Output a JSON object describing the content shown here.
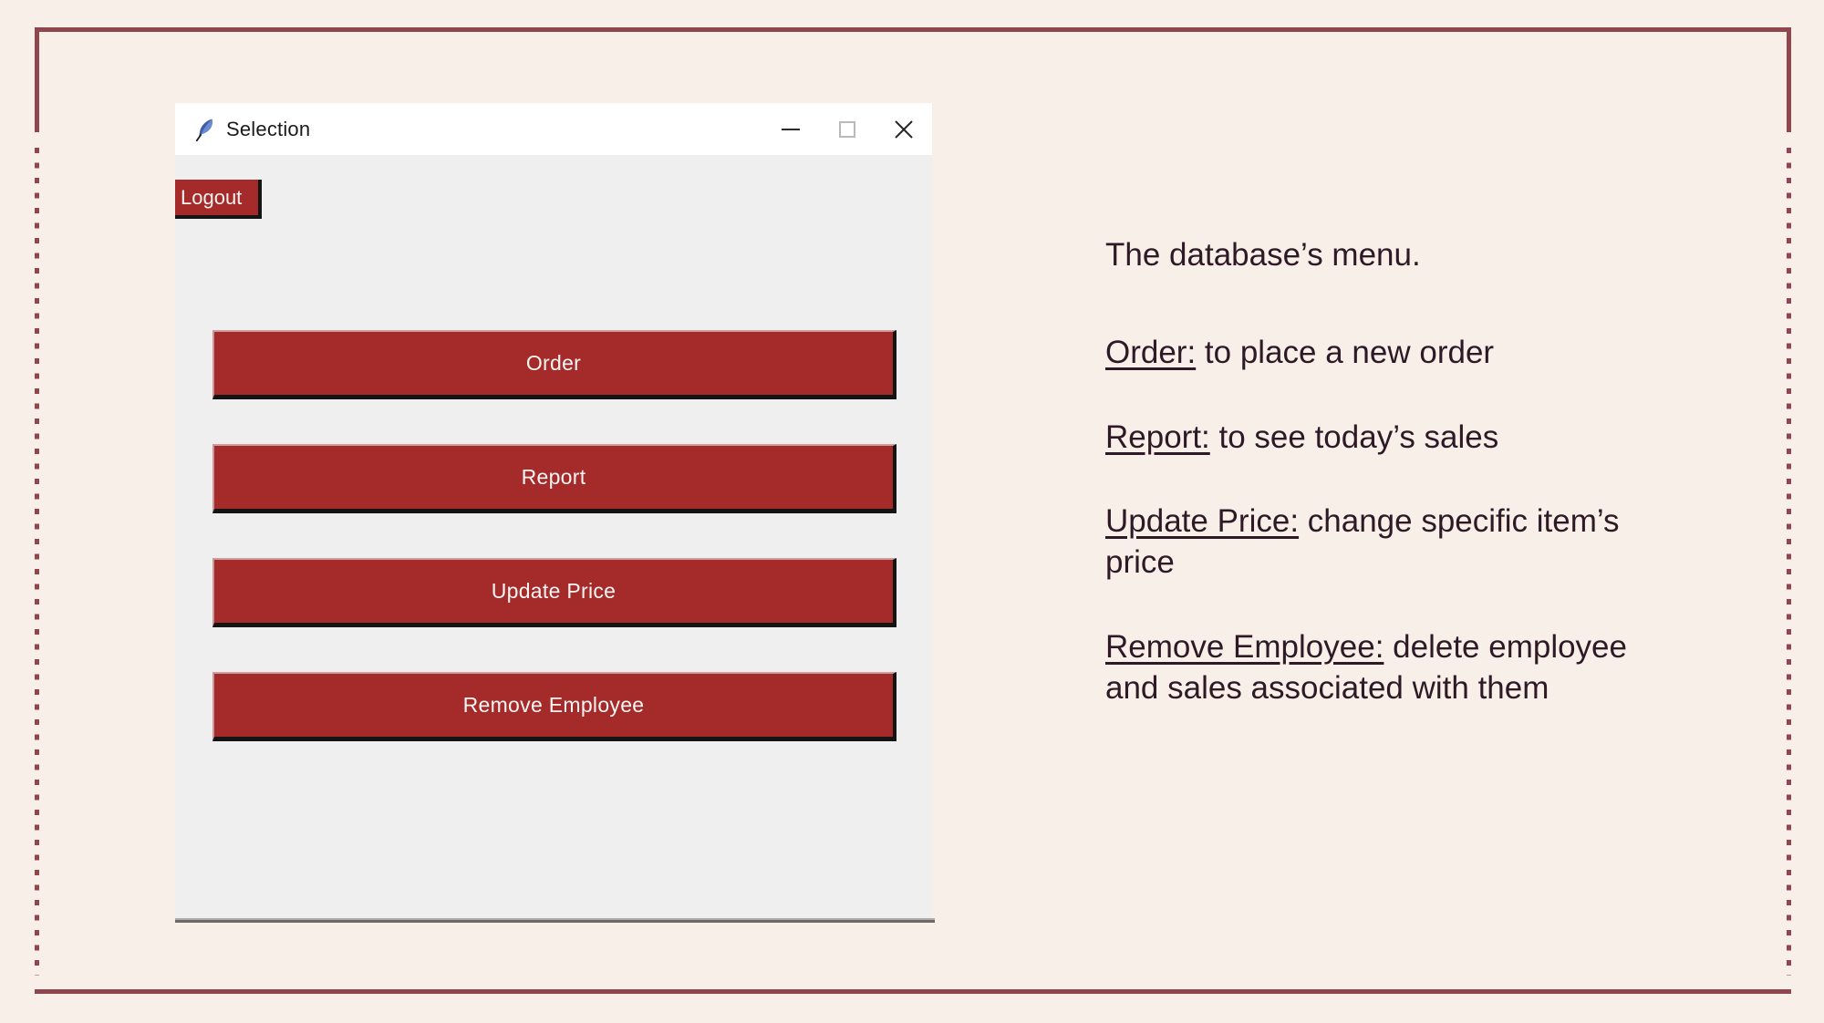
{
  "slide": {
    "background_color": "#F9EFE9",
    "frame_color": "#8F474D"
  },
  "window": {
    "title": "Selection",
    "icon": "feather-quill-icon",
    "background_color": "#EFEFEF",
    "titlebar_color": "#FFFFFF",
    "controls": {
      "minimize": "minimize-icon",
      "maximize": "maximize-icon",
      "close": "close-icon"
    },
    "logout_label": "Logout",
    "button_color": "#A52A2A",
    "button_text_color": "#FAF6F4",
    "menu_buttons": [
      {
        "label": "Order"
      },
      {
        "label": "Report"
      },
      {
        "label": "Update Price"
      },
      {
        "label": "Remove Employee"
      }
    ]
  },
  "notes": {
    "text_color": "#2E1A26",
    "intro": "The database’s menu.",
    "items": [
      {
        "term": "Order:",
        "desc": " to place a new order"
      },
      {
        "term": "Report:",
        "desc": " to see today’s sales"
      },
      {
        "term": "Update Price:",
        "desc": " change specific item’s price"
      },
      {
        "term": "Remove Employee:",
        "desc": " delete employee and sales associated with them"
      }
    ]
  }
}
